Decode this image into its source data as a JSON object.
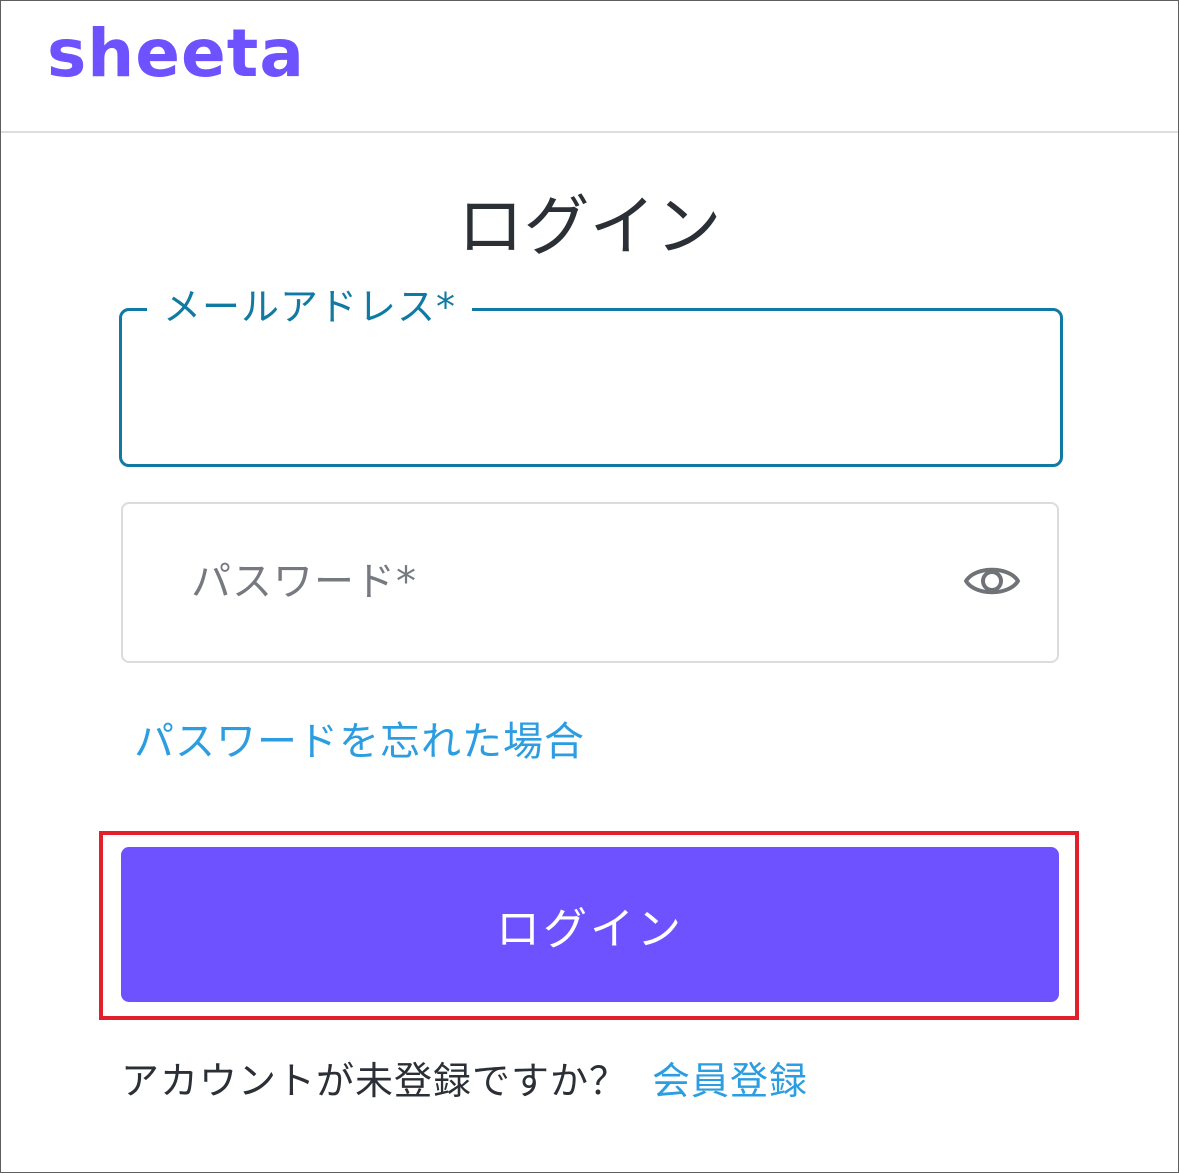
{
  "header": {
    "logo_text": "sheeta"
  },
  "login_form": {
    "title": "ログイン",
    "email": {
      "label": "メールアドレス*",
      "value": ""
    },
    "password": {
      "placeholder": "パスワード*",
      "toggle_icon": "eye-icon"
    },
    "forgot_password_link": "パスワードを忘れた場合",
    "submit_label": "ログイン"
  },
  "signup": {
    "prompt": "アカウントが未登録ですか？",
    "link_label": "会員登録"
  },
  "colors": {
    "brand": "#6e52ff",
    "focus": "#117aa3",
    "link": "#2b9de0",
    "highlight": "#e2202c"
  }
}
